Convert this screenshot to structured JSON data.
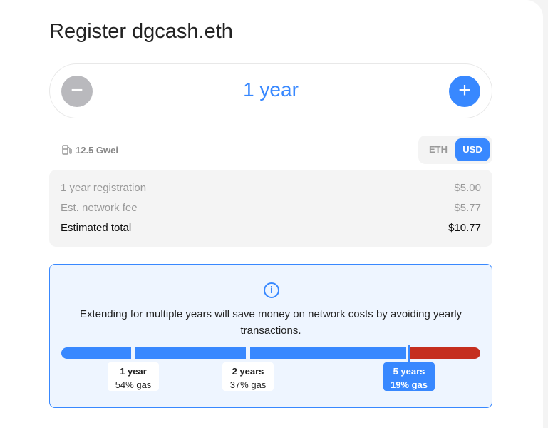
{
  "title": "Register dgcash.eth",
  "stepper": {
    "value": "1 year",
    "minus": "−",
    "plus": "+"
  },
  "gas": {
    "price": "12.5 Gwei"
  },
  "currency": {
    "options": [
      "ETH",
      "USD"
    ],
    "selected": "USD"
  },
  "summary": [
    {
      "label": "1 year registration",
      "value": "$5.00"
    },
    {
      "label": "Est. network fee",
      "value": "$5.77"
    },
    {
      "label": "Estimated total",
      "value": "$10.77"
    }
  ],
  "info": {
    "text": "Extending for multiple years will save money on network costs by avoiding yearly transactions.",
    "marks": [
      {
        "years": "1 year",
        "gas": "54% gas"
      },
      {
        "years": "2 years",
        "gas": "37% gas"
      },
      {
        "years": "5 years",
        "gas": "19% gas",
        "selected": true
      }
    ]
  },
  "colors": {
    "accent": "#3888ff",
    "warning": "#c52e1f"
  }
}
